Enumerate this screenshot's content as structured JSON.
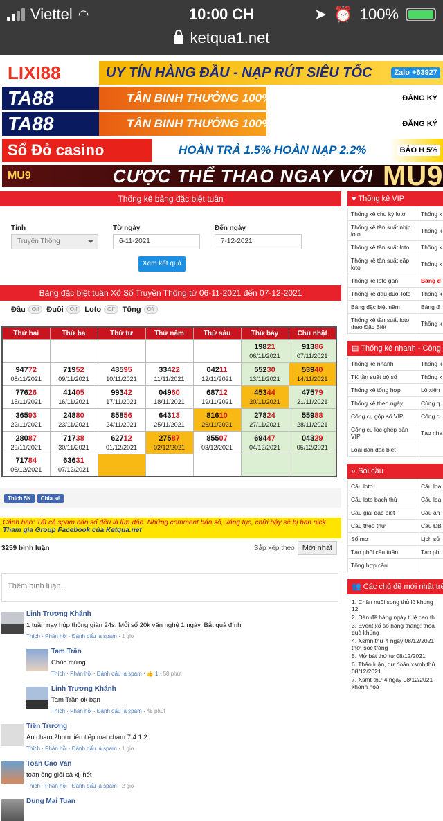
{
  "status": {
    "carrier": "Viettel",
    "time": "10:00 CH",
    "battery": "100%",
    "url": "ketqua1.net"
  },
  "banners": [
    {
      "logo": "LIXI88",
      "slogan": "UY TÍN HÀNG ĐẦU - NẠP RÚT SIÊU TỐC",
      "tag": "Zalo +63927"
    },
    {
      "logo": "TA88",
      "slogan": "TÂN BINH  THƯỞNG 100%",
      "tag": "ĐĂNG KÝ"
    },
    {
      "logo": "TA88",
      "slogan": "TÂN BINH  THƯỞNG 100%",
      "tag": "ĐĂNG KÝ"
    },
    {
      "logo": "Sổ Đỏ casino",
      "slogan": "HOÀN TRẢ 1.5%   HOÀN NẠP 2.2%",
      "tag": "BẢO H 5%"
    },
    {
      "logo": "MU9",
      "slogan": "CƯỢC THỂ THAO NGAY VỚI",
      "tag": "MU9"
    }
  ],
  "form": {
    "title": "Thống kê bảng đặc biệt tuần",
    "tinh_label": "Tỉnh",
    "tinh_value": "Truyền Thống",
    "from_label": "Từ ngày",
    "from_value": "6-11-2021",
    "to_label": "Đến ngày",
    "to_value": "7-12-2021",
    "button": "Xem kết quả"
  },
  "table_title": "Bảng đặc biệt tuần Xổ Số Truyền Thống từ 06-11-2021 đến 07-12-2021",
  "filters": [
    {
      "label": "Đầu",
      "state": "Off"
    },
    {
      "label": "Đuôi",
      "state": "Off"
    },
    {
      "label": "Loto",
      "state": "Off"
    },
    {
      "label": "Tổng",
      "state": "Off"
    }
  ],
  "weekdays": [
    "Thứ hai",
    "Thứ ba",
    "Thứ tư",
    "Thứ năm",
    "Thứ sáu",
    "Thứ bảy",
    "Chủ nhật"
  ],
  "rows": [
    [
      null,
      null,
      null,
      null,
      null,
      {
        "p": "198",
        "s": "21",
        "d": "06/11/2021",
        "c": "g"
      },
      {
        "p": "913",
        "s": "86",
        "d": "07/11/2021",
        "c": "g"
      }
    ],
    [
      {
        "p": "947",
        "s": "72",
        "d": "08/11/2021"
      },
      {
        "p": "719",
        "s": "52",
        "d": "09/11/2021"
      },
      {
        "p": "435",
        "s": "95",
        "d": "10/11/2021"
      },
      {
        "p": "334",
        "s": "22",
        "d": "11/11/2021"
      },
      {
        "p": "042",
        "s": "11",
        "d": "12/11/2021"
      },
      {
        "p": "552",
        "s": "30",
        "d": "13/11/2021",
        "c": "g"
      },
      {
        "p": "539",
        "s": "40",
        "d": "14/11/2021",
        "c": "o"
      }
    ],
    [
      {
        "p": "776",
        "s": "26",
        "d": "15/11/2021"
      },
      {
        "p": "414",
        "s": "05",
        "d": "16/11/2021"
      },
      {
        "p": "993",
        "s": "42",
        "d": "17/11/2021"
      },
      {
        "p": "049",
        "s": "60",
        "d": "18/11/2021"
      },
      {
        "p": "687",
        "s": "12",
        "d": "19/11/2021"
      },
      {
        "p": "453",
        "s": "44",
        "d": "20/11/2021",
        "c": "o"
      },
      {
        "p": "475",
        "s": "79",
        "d": "21/11/2021",
        "c": "g"
      }
    ],
    [
      {
        "p": "365",
        "s": "93",
        "d": "22/11/2021"
      },
      {
        "p": "248",
        "s": "80",
        "d": "23/11/2021"
      },
      {
        "p": "858",
        "s": "56",
        "d": "24/11/2021"
      },
      {
        "p": "643",
        "s": "13",
        "d": "25/11/2021"
      },
      {
        "p": "816",
        "s": "10",
        "d": "26/11/2021",
        "c": "o"
      },
      {
        "p": "278",
        "s": "24",
        "d": "27/11/2021",
        "c": "g"
      },
      {
        "p": "559",
        "s": "88",
        "d": "28/11/2021",
        "c": "g"
      }
    ],
    [
      {
        "p": "280",
        "s": "87",
        "d": "29/11/2021"
      },
      {
        "p": "717",
        "s": "38",
        "d": "30/11/2021"
      },
      {
        "p": "627",
        "s": "12",
        "d": "01/12/2021"
      },
      {
        "p": "275",
        "s": "87",
        "d": "02/12/2021",
        "c": "o"
      },
      {
        "p": "855",
        "s": "07",
        "d": "03/12/2021"
      },
      {
        "p": "694",
        "s": "47",
        "d": "04/12/2021",
        "c": "g"
      },
      {
        "p": "043",
        "s": "29",
        "d": "05/12/2021",
        "c": "g"
      }
    ],
    [
      {
        "p": "717",
        "s": "84",
        "d": "06/12/2021"
      },
      {
        "p": "636",
        "s": "31",
        "d": "07/12/2021"
      },
      {
        "c": "o"
      },
      {
        "c": "w"
      },
      {
        "c": "w"
      },
      {
        "c": "g"
      },
      {
        "c": "g"
      }
    ]
  ],
  "fb": {
    "like": "Thích 5K",
    "share": "Chia sẻ"
  },
  "warning": {
    "text": "Cảnh báo: Tất cả spam bán số đều là lừa đảo. Những comment bán số, văng tục, chửi bậy sẽ bị ban nick.",
    "group": "Tham gia Group Facebook của Ketqua.net"
  },
  "comments_bar": {
    "count": "3259 bình luận",
    "sort_label": "Sắp xếp theo",
    "sort_value": "Mới nhất",
    "placeholder": "Thêm bình luận..."
  },
  "comments": [
    {
      "name": "Linh Trương Khánh",
      "text": "1 tuần nay húp thông giàn 24s. Mỗi số 20k văn nghệ 1 ngày. Bắt quả đính",
      "actions": "Thích · Phản hồi · Đánh dấu là spam ·",
      "time": "1 giờ",
      "reply": false,
      "av": "a1"
    },
    {
      "name": "Tam Trần",
      "text": "Chúc mừng",
      "actions": "Thích · Phản hồi · Đánh dấu là spam · 👍 1 ·",
      "time": "58 phút",
      "reply": true,
      "av": "a2"
    },
    {
      "name": "Linh Trương Khánh",
      "text": "Tam Trần ok bạn",
      "actions": "Thích · Phản hồi · Đánh dấu là spam ·",
      "time": "48 phút",
      "reply": true,
      "av": "a3"
    },
    {
      "name": "Tiên Trương",
      "text": "An cham 2hom liên tiếp mai cham 7.4.1.2",
      "actions": "Thích · Phản hồi · Đánh dấu là spam ·",
      "time": "1 giờ",
      "reply": false,
      "av": "a4"
    },
    {
      "name": "Toan Cao Van",
      "text": "toàn ông giỏi cả xịj hết",
      "actions": "Thích · Phản hồi · Đánh dấu là spam ·",
      "time": "2 giờ",
      "reply": false,
      "av": "a5"
    },
    {
      "name": "Dung Mai Tuan",
      "text": "",
      "actions": "",
      "time": "",
      "reply": false,
      "av": "a6"
    }
  ],
  "side": {
    "vip_title": "Thống kê VIP",
    "vip": [
      [
        "Thống kê chu kỳ loto",
        "Thống k"
      ],
      [
        "Thống kê tần suất nhịp loto",
        "Thống k đặc biệ"
      ],
      [
        "Thống kê tần suất loto",
        "Thống k loto"
      ],
      [
        "Thống kê tần suất cặp loto",
        "Thống k dàn cù"
      ],
      [
        "Thống kê loto gan",
        "Bảng đ"
      ],
      [
        "Thống kê đầu đuôi loto",
        "Thống k"
      ],
      [
        "Bảng đặc biệt năm",
        "Bảng đ"
      ],
      [
        "Thống kê tần suất loto theo Đặc Biệt",
        "Thống k đặc biệ"
      ]
    ],
    "quick_title": "Thống kê nhanh - Công",
    "quick": [
      [
        "Thống kê nhanh",
        "Thống k"
      ],
      [
        "TK tần suất bộ số",
        "Thống k"
      ],
      [
        "Thống kê tổng hợp",
        "Lô xiên"
      ],
      [
        "Thống kê theo ngày",
        "Cùng q"
      ],
      [
        "Công cụ gộp số VIP",
        "Công c"
      ],
      [
        "Công cụ lọc ghép dàn VIP",
        "Tạo nha biệt"
      ],
      [
        "Loại dàn đặc biệt",
        ""
      ]
    ],
    "soi_title": "Soi cầu",
    "soi": [
      [
        "Cầu loto",
        "Cầu loa"
      ],
      [
        "Cầu loto bạch thủ",
        "Cầu loa"
      ],
      [
        "Cầu giải đặc biệt",
        "Cầu ăn"
      ],
      [
        "Cầu theo thứ",
        "Cầu ĐB"
      ],
      [
        "Sổ mơ",
        "Lịch sử"
      ],
      [
        "Tạo phôi cầu tuần",
        "Tạo ph"
      ],
      [
        "Tổng hợp cầu",
        ""
      ]
    ],
    "topics_title": "Các chủ đề mới nhất trê",
    "topics": [
      "1. Chăn nuôi song thủ lô khung 12",
      "2. Dàn đề hàng ngày tỉ lệ cao th",
      "3. Event xổ số hàng tháng: thoả quà khủng",
      "4. Xsmn thứ 4 ngày 08/12/2021 thơ, sóc trăng",
      "5. Mở bát thứ tư 08/12/2021",
      "6. Thảo luận, dự đoán xsmb thứ 08/12/2021",
      "7. Xsmt-thứ 4 ngày 08/12/2021 khánh hòa"
    ]
  }
}
